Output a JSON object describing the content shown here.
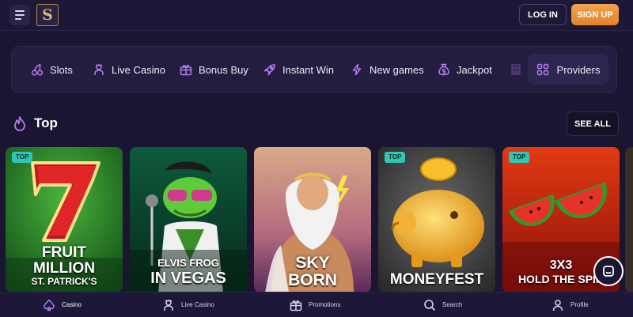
{
  "header": {
    "logo_letter": "S",
    "login_label": "LOG IN",
    "signup_label": "SIGN UP"
  },
  "categories": [
    {
      "label": "Slots",
      "icon": "cherries-icon"
    },
    {
      "label": "Live Casino",
      "icon": "dealer-icon"
    },
    {
      "label": "Bonus Buy",
      "icon": "gift-box-icon"
    },
    {
      "label": "Instant Win",
      "icon": "rocket-icon"
    },
    {
      "label": "New games",
      "icon": "lightning-icon"
    },
    {
      "label": "Jackpot",
      "icon": "money-bag-icon"
    },
    {
      "label": "Providers",
      "icon": "grid-icon"
    }
  ],
  "section": {
    "title": "Top",
    "see_all_label": "SEE ALL"
  },
  "games": [
    {
      "badge": "TOP",
      "lines": [
        "FRUIT",
        "MILLION",
        "ST. PATRICK'S"
      ]
    },
    {
      "badge": "",
      "lines": [
        "ELVIS FROG",
        "IN VEGAS"
      ]
    },
    {
      "badge": "",
      "lines": [
        "SKY",
        "BORN"
      ]
    },
    {
      "badge": "TOP",
      "lines": [
        "MONEYFEST"
      ]
    },
    {
      "badge": "TOP",
      "lines": [
        "3X3",
        "HOLD THE SPIN"
      ]
    }
  ],
  "bottom_nav": [
    {
      "label": "Casino",
      "icon": "spade-icon"
    },
    {
      "label": "Live Casino",
      "icon": "dealer-icon"
    },
    {
      "label": "Promotions",
      "icon": "gift-icon"
    },
    {
      "label": "Search",
      "icon": "search-icon"
    },
    {
      "label": "Profile",
      "icon": "user-icon"
    }
  ],
  "colors": {
    "background": "#1a1530",
    "accent_orange": "#e98f36",
    "accent_purple": "#b77cf0",
    "badge_teal": "#2ec7b6"
  }
}
